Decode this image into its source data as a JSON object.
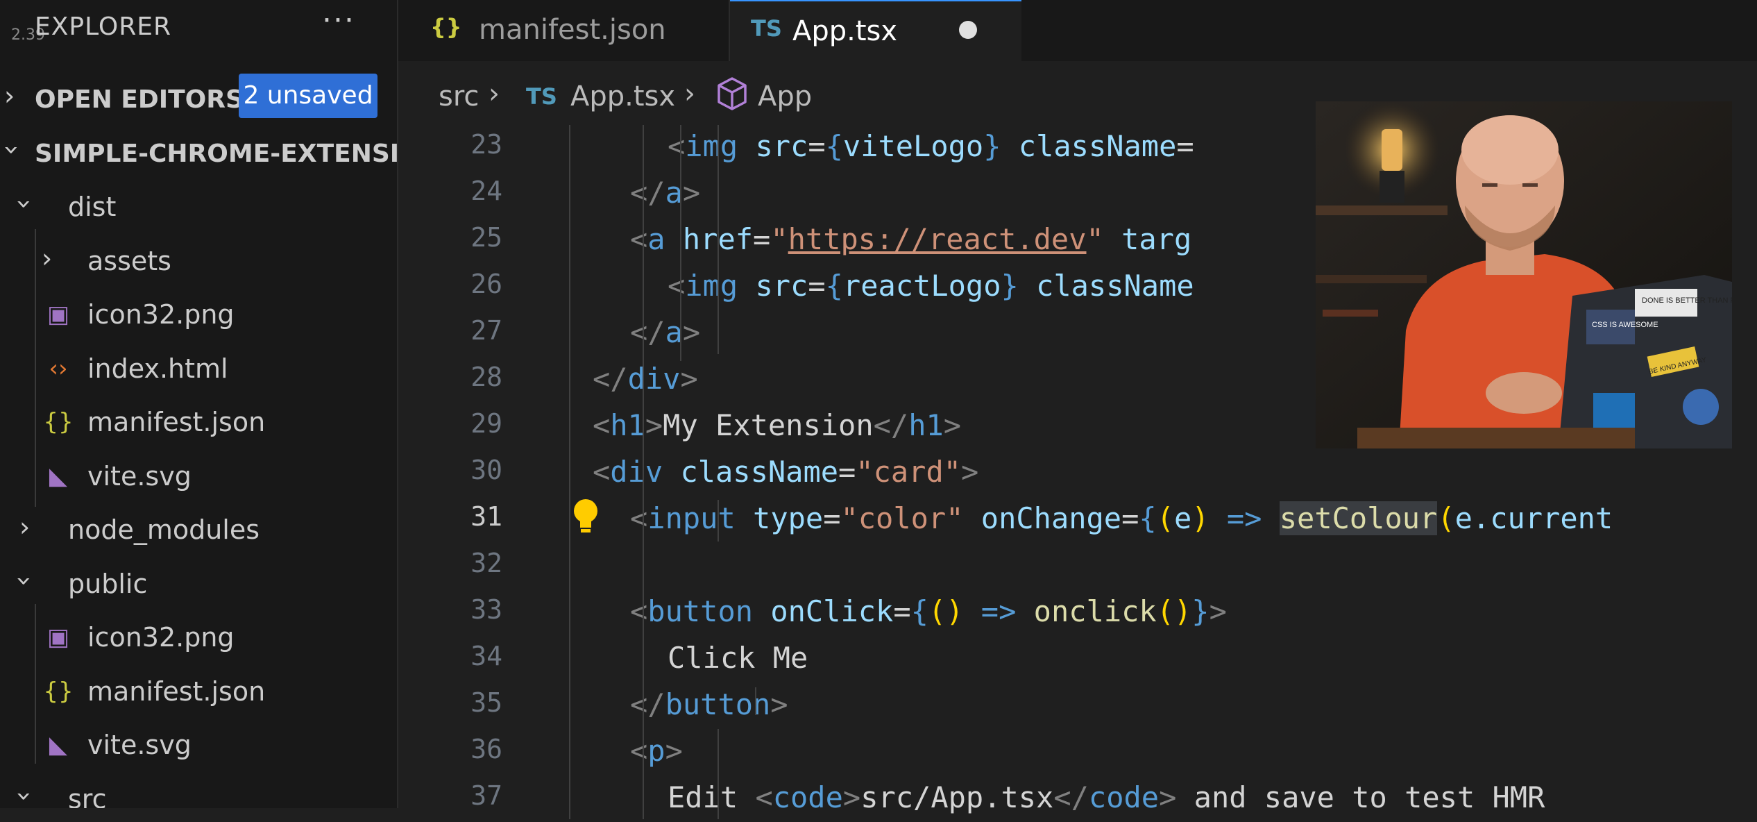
{
  "overlay_number": "2.39",
  "explorer": {
    "title": "EXPLORER",
    "more_actions": "···",
    "open_editors": {
      "label": "OPEN EDITORS",
      "badge": "2 unsaved"
    },
    "project": {
      "label": "SIMPLE-CHROME-EXTENSI..."
    },
    "tree": [
      {
        "label": "dist",
        "type": "folder",
        "expanded": true
      },
      {
        "label": "assets",
        "type": "folder",
        "expanded": false
      },
      {
        "label": "icon32.png",
        "type": "image"
      },
      {
        "label": "index.html",
        "type": "html"
      },
      {
        "label": "manifest.json",
        "type": "json"
      },
      {
        "label": "vite.svg",
        "type": "svg"
      },
      {
        "label": "node_modules",
        "type": "folder",
        "expanded": false
      },
      {
        "label": "public",
        "type": "folder",
        "expanded": true
      },
      {
        "label": "icon32.png",
        "type": "image"
      },
      {
        "label": "manifest.json",
        "type": "json"
      },
      {
        "label": "vite.svg",
        "type": "svg"
      },
      {
        "label": "src",
        "type": "folder",
        "expanded": true
      }
    ]
  },
  "tabs": [
    {
      "icon": "{}",
      "label": "manifest.json",
      "active": false
    },
    {
      "icon": "TS",
      "label": "App.tsx",
      "active": true,
      "dirty": true
    }
  ],
  "breadcrumb": [
    {
      "label": "src"
    },
    {
      "icon": "TS",
      "label": "App.tsx"
    },
    {
      "icon": "cube",
      "label": "App"
    }
  ],
  "editor": {
    "current_line": "31",
    "lines": [
      {
        "n": "23",
        "tokens": [
          [
            "<",
            "tag"
          ],
          [
            "img",
            "name"
          ],
          [
            " ",
            "text"
          ],
          [
            "src",
            "attr"
          ],
          [
            "=",
            "text"
          ],
          [
            "{",
            "brace"
          ],
          [
            "viteLogo",
            "dim"
          ],
          [
            "}",
            "brace"
          ],
          [
            " ",
            "text"
          ],
          [
            "className",
            "attr"
          ],
          [
            "=",
            "text"
          ]
        ]
      },
      {
        "n": "24",
        "tokens": [
          [
            "</",
            "tag"
          ],
          [
            "a",
            "name"
          ],
          [
            ">",
            "tag"
          ]
        ]
      },
      {
        "n": "25",
        "tokens": [
          [
            "<",
            "tag"
          ],
          [
            "a",
            "name"
          ],
          [
            " ",
            "text"
          ],
          [
            "href",
            "attr"
          ],
          [
            "=",
            "text"
          ],
          [
            "\"",
            "str"
          ],
          [
            "https://react.dev",
            "link"
          ],
          [
            "\"",
            "str"
          ],
          [
            " ",
            "text"
          ],
          [
            "targ",
            "attr"
          ]
        ]
      },
      {
        "n": "26",
        "tokens": [
          [
            "<",
            "tag"
          ],
          [
            "img",
            "name"
          ],
          [
            " ",
            "text"
          ],
          [
            "src",
            "attr"
          ],
          [
            "=",
            "text"
          ],
          [
            "{",
            "brace"
          ],
          [
            "reactLogo",
            "dim"
          ],
          [
            "}",
            "brace"
          ],
          [
            " ",
            "text"
          ],
          [
            "className",
            "attr"
          ]
        ]
      },
      {
        "n": "27",
        "tokens": [
          [
            "</",
            "tag"
          ],
          [
            "a",
            "name"
          ],
          [
            ">",
            "tag"
          ]
        ]
      },
      {
        "n": "28",
        "tokens": [
          [
            "</",
            "tag"
          ],
          [
            "div",
            "name"
          ],
          [
            ">",
            "tag"
          ]
        ]
      },
      {
        "n": "29",
        "tokens": [
          [
            "<",
            "tag"
          ],
          [
            "h1",
            "name"
          ],
          [
            ">",
            "tag"
          ],
          [
            "My Extension",
            "text"
          ],
          [
            "</",
            "tag"
          ],
          [
            "h1",
            "name"
          ],
          [
            ">",
            "tag"
          ]
        ]
      },
      {
        "n": "30",
        "tokens": [
          [
            "<",
            "tag"
          ],
          [
            "div",
            "name"
          ],
          [
            " ",
            "text"
          ],
          [
            "className",
            "attr"
          ],
          [
            "=",
            "text"
          ],
          [
            "\"card\"",
            "str"
          ],
          [
            ">",
            "tag"
          ]
        ]
      },
      {
        "n": "31",
        "tokens": [
          [
            "<",
            "tag"
          ],
          [
            "input",
            "name"
          ],
          [
            " ",
            "text"
          ],
          [
            "type",
            "attr"
          ],
          [
            "=",
            "text"
          ],
          [
            "\"color\"",
            "str"
          ],
          [
            " ",
            "text"
          ],
          [
            "onChange",
            "attr"
          ],
          [
            "=",
            "text"
          ],
          [
            "{",
            "brace"
          ],
          [
            "(",
            "paren"
          ],
          [
            "e",
            "dim"
          ],
          [
            ")",
            "paren"
          ],
          [
            " ",
            "text"
          ],
          [
            "=>",
            "arrow"
          ],
          [
            " ",
            "text"
          ],
          [
            "setColour",
            "sel"
          ],
          [
            "(",
            "paren"
          ],
          [
            "e.current",
            "dim"
          ]
        ]
      },
      {
        "n": "32",
        "tokens": []
      },
      {
        "n": "33",
        "tokens": [
          [
            "<",
            "tag"
          ],
          [
            "button",
            "name"
          ],
          [
            " ",
            "text"
          ],
          [
            "onClick",
            "attr"
          ],
          [
            "=",
            "text"
          ],
          [
            "{",
            "brace"
          ],
          [
            "()",
            "paren"
          ],
          [
            " ",
            "text"
          ],
          [
            "=>",
            "arrow"
          ],
          [
            " ",
            "text"
          ],
          [
            "onclick",
            "fn"
          ],
          [
            "()",
            "paren"
          ],
          [
            "}",
            "brace"
          ],
          [
            ">",
            "tag"
          ]
        ]
      },
      {
        "n": "34",
        "tokens": [
          [
            "Click Me",
            "text"
          ]
        ]
      },
      {
        "n": "35",
        "tokens": [
          [
            "</",
            "tag"
          ],
          [
            "button",
            "name"
          ],
          [
            ">",
            "tag"
          ]
        ]
      },
      {
        "n": "36",
        "tokens": [
          [
            "<",
            "tag"
          ],
          [
            "p",
            "name"
          ],
          [
            ">",
            "tag"
          ]
        ]
      },
      {
        "n": "37",
        "tokens": [
          [
            "Edit ",
            "text"
          ],
          [
            "<",
            "tag"
          ],
          [
            "code",
            "name"
          ],
          [
            ">",
            "tag"
          ],
          [
            "src/App.tsx",
            "text"
          ],
          [
            "</",
            "tag"
          ],
          [
            "code",
            "name"
          ],
          [
            ">",
            "tag"
          ],
          [
            " and save to test HMR",
            "text"
          ]
        ]
      }
    ]
  },
  "webcam": {
    "sticker_1": "DONE IS BETTER THAN PERFECT",
    "sticker_2": "CSS IS AWESOME",
    "sticker_3": "BE KIND ANYWAY"
  },
  "colors": {
    "sidebar_bg": "#181818",
    "editor_bg": "#1f1f1f",
    "badge_bg": "#2f6fd6",
    "json_icon": "#cbcb41",
    "ts_icon": "#519aba",
    "html_icon": "#e37933",
    "image_icon": "#a074c4",
    "svg_icon": "#a074c4"
  }
}
